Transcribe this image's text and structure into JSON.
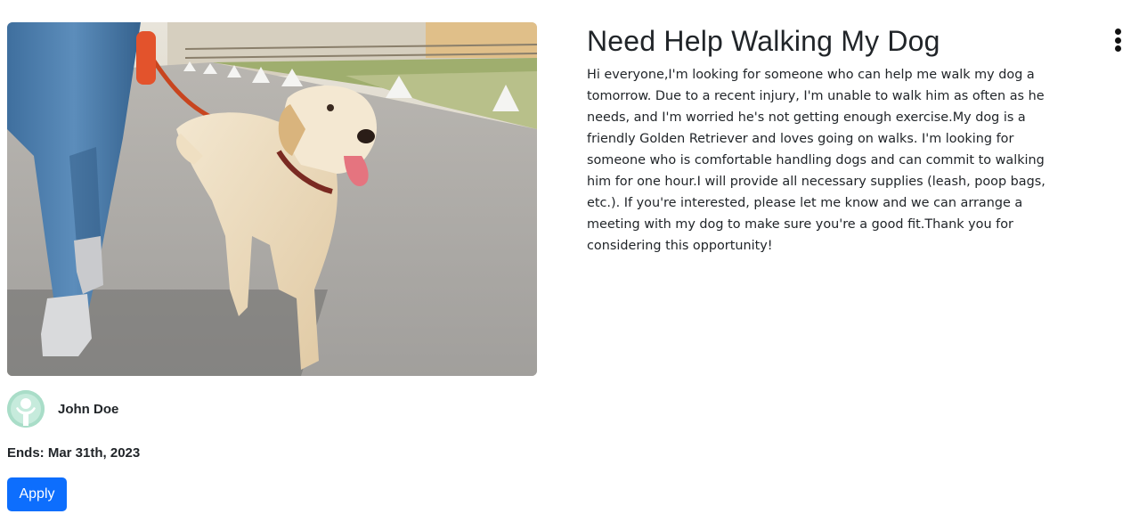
{
  "post": {
    "title": "Need Help Walking My Dog",
    "description": "Hi everyone,I'm looking for someone who can help me walk my dog a tomorrow. Due to a recent injury, I'm unable to walk him as often as he needs, and I'm worried he's not getting enough exercise.My dog is a friendly Golden Retriever and loves going on walks. I'm looking for someone who is comfortable handling dogs and can commit to walking him for one hour.I will provide all necessary supplies (leash, poop bags, etc.). If you're interested, please let me know and we can arrange a meeting with my dog to make sure you're a good fit.Thank you for considering this opportunity!",
    "image_description": "dog-walking-photo",
    "poster_name": "John Doe",
    "ends_label": "Ends:",
    "ends_value": "Mar 31th, 2023",
    "apply_label": "Apply",
    "menu_icon": "more-vertical-icon"
  },
  "colors": {
    "accent": "#0d6efd",
    "text": "#212529",
    "avatar": "#a9ddc8"
  }
}
